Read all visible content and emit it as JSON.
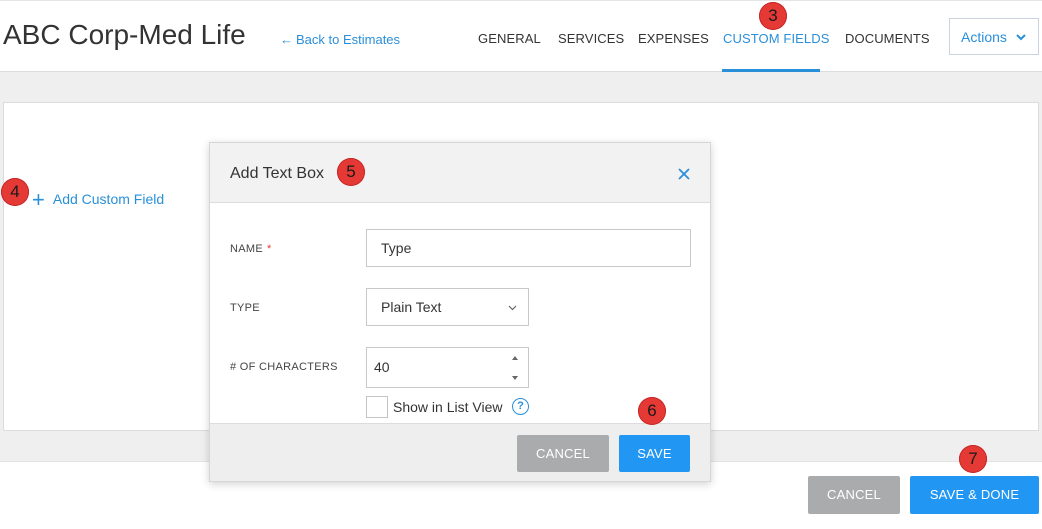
{
  "header": {
    "title": "ABC Corp-Med Life",
    "back_link": "Back to Estimates",
    "tabs": [
      "GENERAL",
      "SERVICES",
      "EXPENSES",
      "CUSTOM FIELDS",
      "DOCUMENTS"
    ],
    "active_tab": "CUSTOM FIELDS",
    "actions_label": "Actions"
  },
  "content": {
    "add_custom_field": "Add Custom Field"
  },
  "modal": {
    "title": "Add Text Box",
    "name_label": "NAME",
    "required_mark": "*",
    "name_value": "Type",
    "type_label": "TYPE",
    "type_value": "Plain Text",
    "chars_label": "# OF CHARACTERS",
    "chars_value": "40",
    "show_in_list_label": "Show in List View",
    "show_in_list_checked": false,
    "help_glyph": "?",
    "cancel_label": "CANCEL",
    "save_label": "SAVE"
  },
  "footer": {
    "cancel_label": "CANCEL",
    "save_done_label": "SAVE & DONE"
  },
  "markers": [
    "3",
    "4",
    "5",
    "6",
    "7"
  ],
  "colors": {
    "accent": "#2a8fd9",
    "primary_button": "#2196f3",
    "secondary_button": "#a9abad",
    "marker": "#e53935"
  },
  "icons": [
    "back-arrow-icon",
    "chevron-down-icon",
    "plus-icon",
    "close-icon",
    "stepper-up-icon",
    "stepper-down-icon",
    "help-icon"
  ]
}
